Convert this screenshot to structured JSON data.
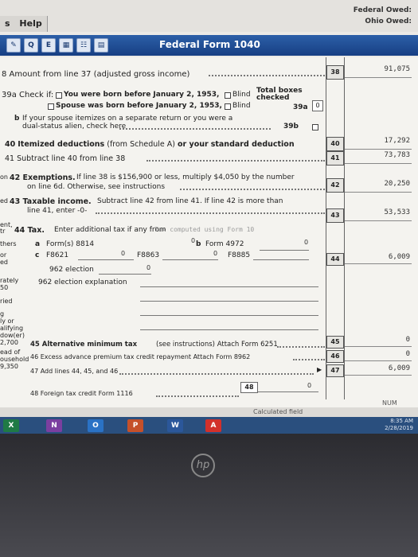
{
  "header": {
    "help_menu": "Help",
    "federal_owed": "Federal Owed:",
    "ohio_owed": "Ohio Owed:",
    "menu_prefix": "s"
  },
  "window": {
    "title": "Federal Form 1040"
  },
  "toolbar": {
    "icons": [
      "pen-icon",
      "qa-icon",
      "eo-icon",
      "grid-icon",
      "tree-icon",
      "print-icon"
    ]
  },
  "form": {
    "line38": {
      "num": "38",
      "label": "8  Amount from line 37 (adjusted gross income)",
      "amount": "91,075"
    },
    "line39a": {
      "label_prefix": "39a  Check if:",
      "you_text": "You were born before January 2, 1953,",
      "blind": "Blind",
      "spouse_text": "Spouse was born before January 2, 1953,",
      "total_boxes": "Total boxes checked",
      "num": "39a",
      "value": "0"
    },
    "line39b": {
      "label_b": "b",
      "text1": "If your spouse itemizes on a separate return or you were a",
      "text2": "dual-status alien, check here",
      "num": "39b"
    },
    "line40": {
      "num": "40",
      "label_num": "40",
      "label_bold": "Itemized deductions",
      "label_mid": "(from Schedule A)",
      "label_or": "or your",
      "label_std": "standard deduction",
      "amount": "17,292"
    },
    "line41": {
      "num": "41",
      "label": "41  Subtract line 40 from line 38",
      "amount": "73,783"
    },
    "line42": {
      "num": "42",
      "prefix": "on",
      "label_bold": "42  Exemptions.",
      "text1": "If line 38 is $156,900 or less, multiply $4,050 by the number",
      "text2": "on line 6d. Otherwise, see instructions",
      "amount": "20,250"
    },
    "line43": {
      "num": "43",
      "prefix": "ed",
      "label_bold": "43  Taxable income.",
      "text1": "Subtract line 42 from line 41. If line 42 is more than",
      "text2": "line 41, enter -0-",
      "amount": "53,533"
    },
    "line44": {
      "num": "44",
      "label_bold": "44  Tax.",
      "text1": "Enter additional tax if any from",
      "computed_hint": "Tax computed using Form 10",
      "a_label": "a",
      "a_text": "Form(s) 8814",
      "a_val": "0",
      "b_label": "b",
      "b_text": "Form 4972",
      "b_val": "0",
      "c_label": "c",
      "c_text": "F8621",
      "c_val": "0",
      "f8863": "F8863",
      "f8863_val": "0",
      "f8885": "F8885",
      "election": "962 election",
      "election_val": "0",
      "explanation": "962 election explanation",
      "amount": "6,009"
    },
    "line45": {
      "num": "45",
      "label_bold": "45  Alternative minimum tax",
      "text": "(see instructions) Attach Form 6251",
      "amount": "0"
    },
    "line46": {
      "num": "46",
      "text": "46  Excess advance premium tax credit repayment Attach Form 8962",
      "amount": "0"
    },
    "line47": {
      "num": "47",
      "text": "47  Add lines 44, 45, and 46",
      "amount": "6,009"
    },
    "line48": {
      "num": "48",
      "text": "48  Foreign tax credit Form 1116",
      "value": "0"
    },
    "left_cut": {
      "ent": "ent,",
      "tr": "tr",
      "thers": "thers",
      "or": "or",
      "ed": "ed",
      "rately": "rately",
      "n50": "50",
      "ried": "ried",
      "g": "g",
      "ly_or": "ly or",
      "alifying": "alifying",
      "dower": "dow(er)",
      "n2700": "2,700",
      "ead_of": "ead of",
      "ousehold": "ousehold",
      "n9350": "9,350"
    }
  },
  "status": {
    "calculated": "Calculated field",
    "num": "NUM"
  },
  "taskbar": {
    "apps": [
      "X",
      "N",
      "O",
      "P",
      "W",
      "A"
    ],
    "time": "8:35 AM",
    "date": "2/28/2019"
  },
  "bezel": {
    "logo": "hp"
  },
  "colors": {
    "title_bar": "#1f4b91",
    "taskbar": "#2a4f7e",
    "form_bg": "#f4f3ef"
  }
}
